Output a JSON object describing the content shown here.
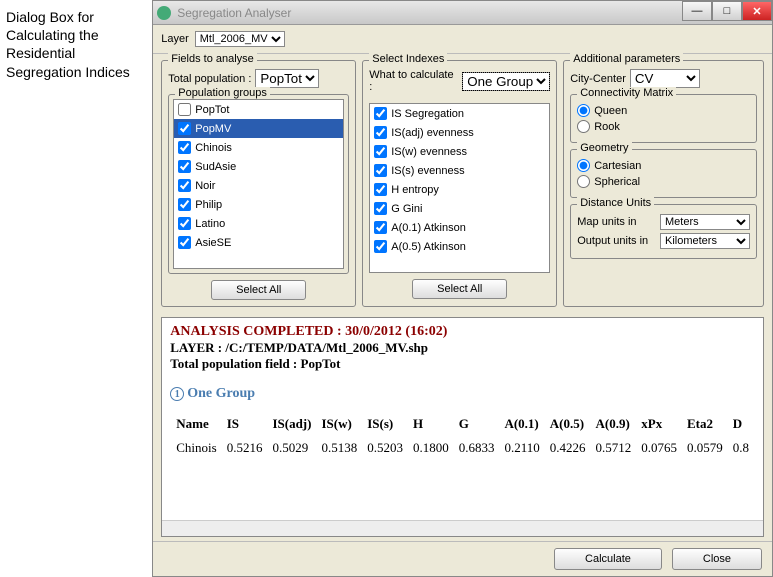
{
  "side_label": "Dialog Box for Calculating the Residential Segregation Indices",
  "window_title": "Segregation Analyser",
  "layer_label": "Layer",
  "layer_value": "Mtl_2006_MV",
  "fields": {
    "legend": "Fields to analyse",
    "totalpop_label": "Total population :",
    "totalpop_value": "PopTot",
    "groups_legend": "Population groups",
    "items": [
      {
        "label": "PopTot",
        "checked": false,
        "selected": false
      },
      {
        "label": "PopMV",
        "checked": true,
        "selected": true
      },
      {
        "label": "Chinois",
        "checked": true,
        "selected": false
      },
      {
        "label": "SudAsie",
        "checked": true,
        "selected": false
      },
      {
        "label": "Noir",
        "checked": true,
        "selected": false
      },
      {
        "label": "Philip",
        "checked": true,
        "selected": false
      },
      {
        "label": "Latino",
        "checked": true,
        "selected": false
      },
      {
        "label": "AsieSE",
        "checked": true,
        "selected": false
      }
    ],
    "select_all": "Select All"
  },
  "indexes": {
    "legend": "Select Indexes",
    "calc_label": "What to calculate :",
    "calc_value": "One Group",
    "items": [
      {
        "label": "IS Segregation",
        "checked": true
      },
      {
        "label": "IS(adj) evenness",
        "checked": true
      },
      {
        "label": "IS(w) evenness",
        "checked": true
      },
      {
        "label": "IS(s) evenness",
        "checked": true
      },
      {
        "label": "H entropy",
        "checked": true
      },
      {
        "label": "G Gini",
        "checked": true
      },
      {
        "label": "A(0.1) Atkinson",
        "checked": true
      },
      {
        "label": "A(0.5) Atkinson",
        "checked": true
      }
    ],
    "select_all": "Select All"
  },
  "params": {
    "legend": "Additional parameters",
    "cc_label": "City-Center",
    "cc_value": "CV",
    "conn_legend": "Connectivity Matrix",
    "queen": "Queen",
    "rook": "Rook",
    "geom_legend": "Geometry",
    "cartesian": "Cartesian",
    "spherical": "Spherical",
    "du_legend": "Distance Units",
    "map_label": "Map units in",
    "map_value": "Meters",
    "output_label": "Output units in",
    "output_value": "Kilometers"
  },
  "results": {
    "completed": "ANALYSIS COMPLETED : 30/0/2012 (16:02)",
    "layer_line": "LAYER : /C:/TEMP/DATA/Mtl_2006_MV.shp",
    "totalpop_line": "Total population field : PopTot",
    "section": "One Group",
    "headers": [
      "Name",
      "IS",
      "IS(adj)",
      "IS(w)",
      "IS(s)",
      "H",
      "G",
      "A(0.1)",
      "A(0.5)",
      "A(0.9)",
      "xPx",
      "Eta2",
      "D"
    ],
    "row": [
      "Chinois",
      "0.5216",
      "0.5029",
      "0.5138",
      "0.5203",
      "0.1800",
      "0.6833",
      "0.2110",
      "0.4226",
      "0.5712",
      "0.0765",
      "0.0579",
      "0.8"
    ]
  },
  "footer": {
    "calculate": "Calculate",
    "close": "Close"
  }
}
